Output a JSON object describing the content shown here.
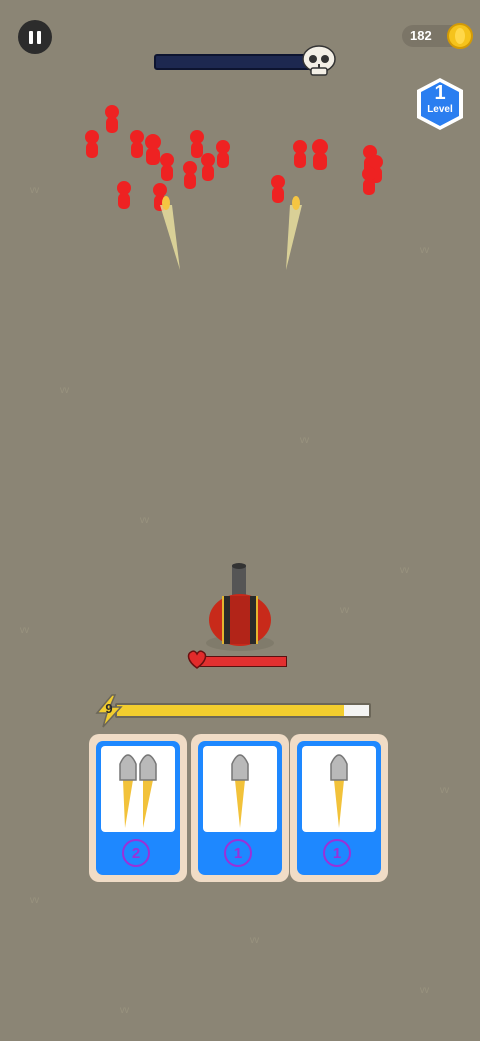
{
  "hud": {
    "coins": "182",
    "level_number": "1",
    "level_label": "Level",
    "energy_count": "9",
    "energy_fill": 0.9,
    "health_fill": 1.0,
    "enemy_progress": 1.0
  },
  "cards": [
    {
      "id": "double-shot",
      "bullets": 2,
      "cost": "2"
    },
    {
      "id": "single-shot",
      "bullets": 1,
      "cost": "1"
    },
    {
      "id": "upgrade-shot",
      "bullets": 1,
      "cost": "1"
    }
  ],
  "colors": {
    "ground": "#8b8575",
    "enemy": "#ee2222",
    "card_blue": "#1e88ff",
    "badge_purple": "#9b30d8",
    "energy_yellow": "#f2cd2e",
    "health_red": "#e23030"
  },
  "icons": [
    "pause-icon",
    "skull-icon",
    "coin-icon",
    "level-badge-icon",
    "heart-icon",
    "lightning-icon",
    "bullet-icon"
  ]
}
